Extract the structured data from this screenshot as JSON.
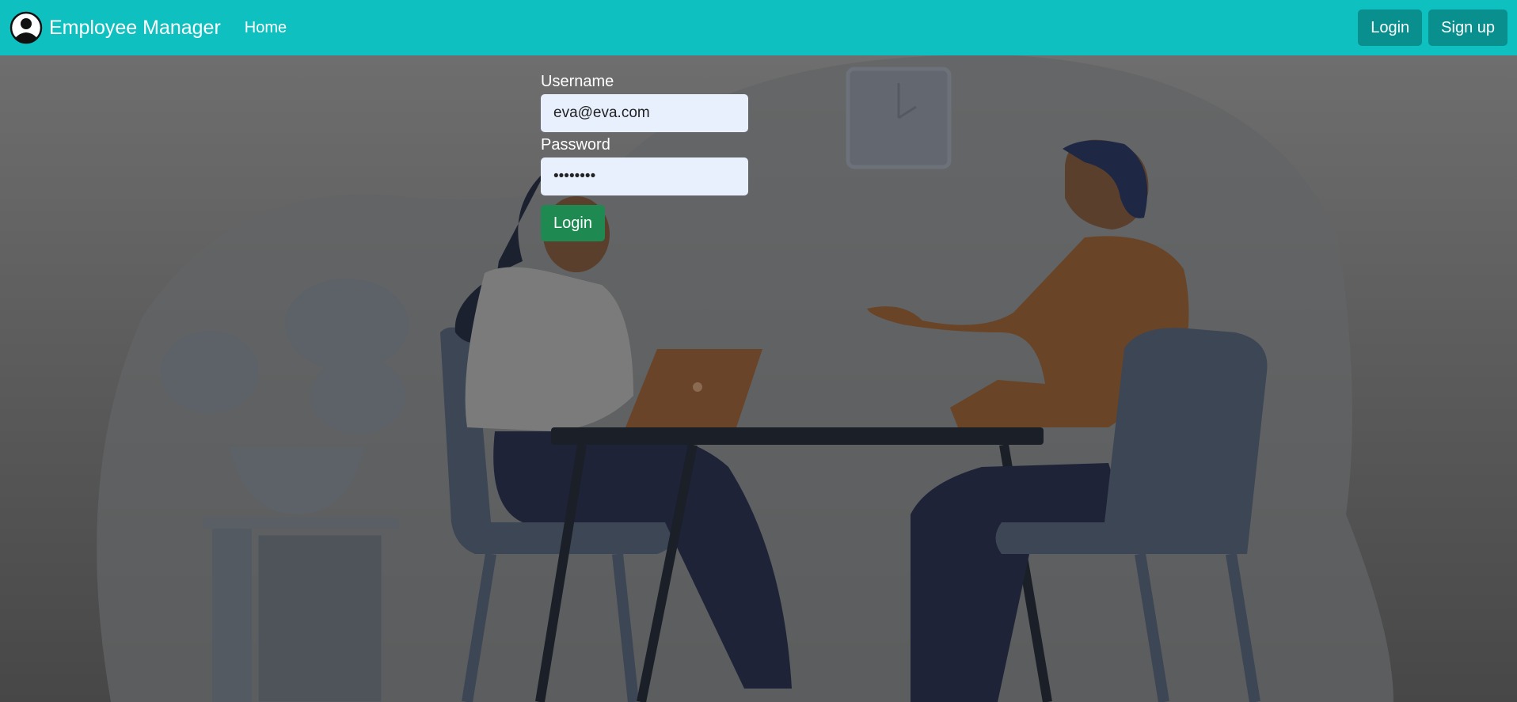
{
  "navbar": {
    "brand_icon": "user-circle-icon",
    "brand_title": "Employee Manager",
    "home_label": "Home",
    "login_label": "Login",
    "signup_label": "Sign up",
    "color": "#0fc0c0"
  },
  "login_form": {
    "username_label": "Username",
    "username_value": "eva@eva.com",
    "password_label": "Password",
    "password_value": "evaeva12",
    "submit_label": "Login",
    "submit_color": "#1e8a52"
  }
}
